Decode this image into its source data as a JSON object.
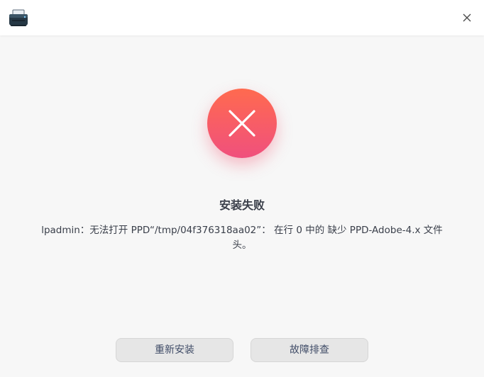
{
  "window": {
    "app_icon": "printer-icon",
    "close_icon": "close-icon"
  },
  "status": {
    "icon": "error-x-icon",
    "title": "安装失败",
    "message": "lpadmin：无法打开 PPD“/tmp/04f376318aa02”： 在行 0 中的 缺少 PPD-Adobe-4.x 文件头。"
  },
  "actions": {
    "reinstall_label": "重新安装",
    "troubleshoot_label": "故障排查"
  },
  "colors": {
    "error_gradient_top": "#ff6a4f",
    "error_gradient_bottom": "#f0507d",
    "background": "#f7f7f7",
    "button_bg": "#e6e6e6",
    "text": "#3a3f4a"
  }
}
